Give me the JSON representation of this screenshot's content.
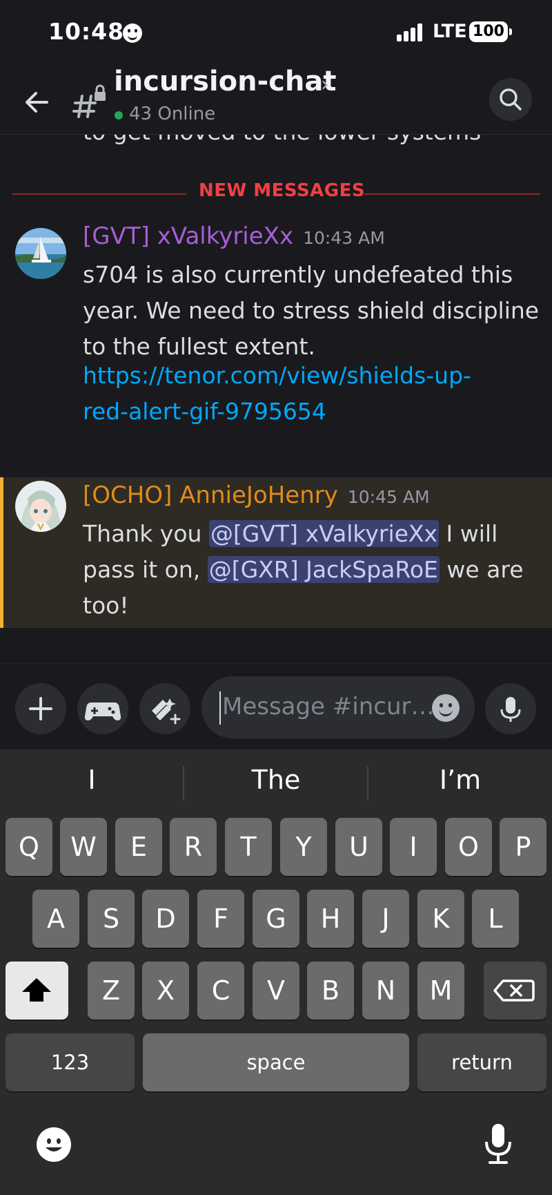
{
  "status_bar": {
    "time": "10:48",
    "network": "LTE",
    "battery": "100"
  },
  "header": {
    "channel_name": "incursion-chat",
    "chevron": "›",
    "online_count": "43 Online"
  },
  "messages_area": {
    "cutoff_text": "to get moved to the lower systems",
    "new_messages_label": "NEW MESSAGES",
    "messages": [
      {
        "author": "[GVT] xValkyrieXx",
        "author_color": "#a75fd6",
        "time": "10:43 AM",
        "lines": [
          "s704 is also currently undefeated this",
          "year. We need to stress shield discipline",
          "to the fullest extent."
        ],
        "link_lines": [
          "https://tenor.com/view/shields-up-",
          "red-alert-gif-9795654"
        ]
      },
      {
        "author": "[OCHO] AnnieJoHenry",
        "author_color": "#e08c1a",
        "time": "10:45 AM",
        "line1_pre": "Thank you ",
        "mention1": "@[GVT] xValkyrieXx",
        "line1_post": " I will",
        "line2_pre": "pass it on, ",
        "mention2": "@[GXR] JackSpaRoE",
        "line2_post": " we are",
        "line3": "too!"
      }
    ]
  },
  "composer": {
    "placeholder": "Message #incur…"
  },
  "keyboard": {
    "suggestions": [
      "I",
      "The",
      "I’m"
    ],
    "row1": [
      "Q",
      "W",
      "E",
      "R",
      "T",
      "Y",
      "U",
      "I",
      "O",
      "P"
    ],
    "row2": [
      "A",
      "S",
      "D",
      "F",
      "G",
      "H",
      "J",
      "K",
      "L"
    ],
    "row3": [
      "Z",
      "X",
      "C",
      "V",
      "B",
      "N",
      "M"
    ],
    "numbers_key": "123",
    "space_key": "space",
    "return_key": "return"
  },
  "colors": {
    "background": "#1a1a1e",
    "accent_new_messages": "#f23f43",
    "link": "#00a8fc",
    "mention_bg": "#3c4270",
    "highlight_border": "#f0b232",
    "online": "#23a55a"
  }
}
